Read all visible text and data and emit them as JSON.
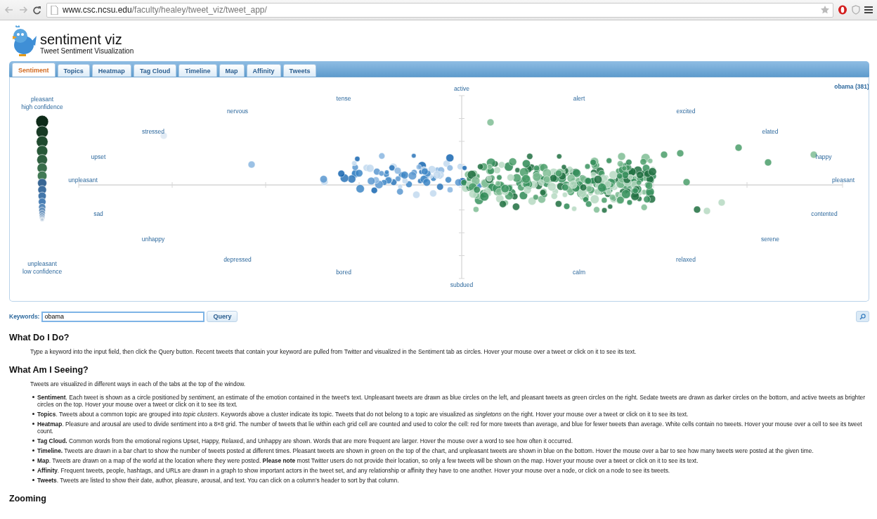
{
  "browser": {
    "url_host": "www.csc.ncsu.edu",
    "url_path": "/faculty/healey/tweet_viz/tweet_app/"
  },
  "app": {
    "title": "sentiment viz",
    "subtitle": "Tweet Sentiment Visualization"
  },
  "tabs": [
    {
      "label": "Sentiment",
      "selected": true
    },
    {
      "label": "Topics",
      "selected": false
    },
    {
      "label": "Heatmap",
      "selected": false
    },
    {
      "label": "Tag Cloud",
      "selected": false
    },
    {
      "label": "Timeline",
      "selected": false
    },
    {
      "label": "Map",
      "selected": false
    },
    {
      "label": "Affinity",
      "selected": false
    },
    {
      "label": "Tweets",
      "selected": false
    }
  ],
  "chart": {
    "query_label": "obama (381)",
    "legend_top": [
      "pleasant",
      "high confidence"
    ],
    "legend_bottom": [
      "unpleasant",
      "low confidence"
    ],
    "labels": [
      "active",
      "tense",
      "alert",
      "nervous",
      "excited",
      "stressed",
      "elated",
      "upset",
      "happy",
      "unpleasant",
      "pleasant",
      "sad",
      "contented",
      "unhappy",
      "serene",
      "depressed",
      "relaxed",
      "bored",
      "calm",
      "subdued"
    ]
  },
  "keywords": {
    "label": "Keywords:",
    "value": "obama"
  },
  "query_button": "Query",
  "sections": [
    {
      "heading": "What Do I Do?",
      "paragraphs": [
        "Type a keyword into the input field, then click the Query button. Recent tweets that contain your keyword are pulled from Twitter and visualized in the Sentiment tab as circles. Hover your mouse over a tweet or click on it to see its text."
      ]
    },
    {
      "heading": "What Am I Seeing?",
      "paragraphs": [
        "Tweets are visualized in different ways in each of the tabs at the top of the window."
      ],
      "items": [
        "**Sentiment**. Each tweet is shown as a circle positioned by *sentiment*, an estimate of the emotion contained in the tweet's text. Unpleasant tweets are drawn as blue circles on the left, and pleasant tweets as green circles on the right. Sedate tweets are drawn as darker circles on the bottom, and active tweets as brighter circles on the top. Hover your mouse over a tweet or click on it to see its text.",
        "**Topics**. Tweets about a common topic are grouped into *topic clusters*. Keywords above a cluster indicate its topic. Tweets that do not belong to a topic are visualized as *singletons* on the right. Hover your mouse over a tweet or click on it to see its text.",
        "**Heatmap**. Pleasure and arousal are used to divide sentiment into a 8×8 grid. The number of tweets that lie within each grid cell are counted and used to color the cell: red for more tweets than average, and blue for fewer tweets than average. White cells contain no tweets. Hover your mouse over a cell to see its tweet count.",
        "**Tag Cloud.** Common words from the emotional regions Upset, Happy, Relaxed, and Unhappy are shown. Words that are more frequent are larger. Hover the mouse over a word to see how often it occurred.",
        "**Timeline.** Tweets are drawn in a bar chart to show the number of tweets posted at different times. Pleasant tweets are shown in green on the top of the chart, and unpleasant tweets are shown in blue on the bottom. Hover the mouse over a bar to see how many tweets were posted at the given time.",
        "**Map**. Tweets are drawn on a map of the world at the location where they were posted. **Please note** most Twitter users do not provide their location, so only a few tweets will be shown on the map. Hover your mouse over a tweet or click on it to see its text.",
        "**Affinity**. Frequent tweets, people, hashtags, and URLs are drawn in a graph to show important actors in the tweet set, and any relationship or affinity they have to one another. Hover your mouse over a node, or click on a node to see its tweets.",
        "**Tweets**. Tweets are listed to show their date, author, pleasure, arousal, and text. You can click on a column's header to sort by that column."
      ]
    },
    {
      "heading": "Zooming"
    }
  ]
}
